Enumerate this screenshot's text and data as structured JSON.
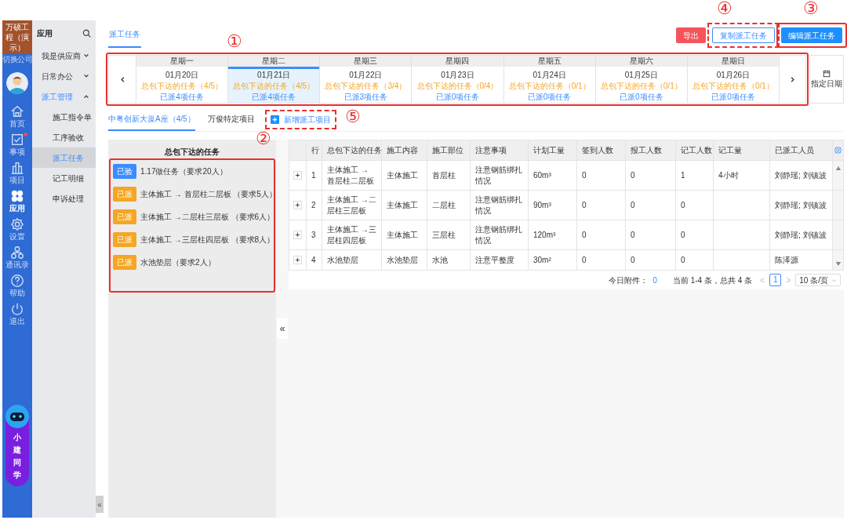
{
  "rail": {
    "brand": "万硕工程（演示）",
    "switch_label": "切换公司",
    "items": [
      {
        "label": "首页",
        "selected": false,
        "badge": false
      },
      {
        "label": "事项",
        "selected": false,
        "badge": true
      },
      {
        "label": "项目",
        "selected": false,
        "badge": false
      },
      {
        "label": "应用",
        "selected": true,
        "badge": false
      },
      {
        "label": "设置",
        "selected": false,
        "badge": false
      },
      {
        "label": "通讯录",
        "selected": false,
        "badge": false
      },
      {
        "label": "帮助",
        "selected": false,
        "badge": false
      },
      {
        "label": "退出",
        "selected": false,
        "badge": false
      }
    ],
    "assistant": "小建同学"
  },
  "sidebar": {
    "title": "应用",
    "items": [
      {
        "label": "我是供应商",
        "expanded": false
      },
      {
        "label": "日常办公",
        "expanded": false
      },
      {
        "label": "派工管理",
        "expanded": true,
        "children": [
          {
            "label": "施工指令单",
            "selected": false
          },
          {
            "label": "工序验收",
            "selected": false
          },
          {
            "label": "派工任务",
            "selected": true
          },
          {
            "label": "记工明细",
            "selected": false
          },
          {
            "label": "申诉处理",
            "selected": false
          }
        ]
      }
    ]
  },
  "page_tabs": [
    {
      "label": "派工任务",
      "selected": true
    }
  ],
  "actions": [
    {
      "label": "导出",
      "kind": "danger"
    },
    {
      "label": "复制派工任务",
      "kind": "outline"
    },
    {
      "label": "编辑派工任务",
      "kind": "primary"
    }
  ],
  "week": {
    "days": [
      {
        "weekday": "星期一",
        "date": "01月20日",
        "issued": "总包下达的任务（4/5）",
        "dispatched": "已派4项任务",
        "selected": false
      },
      {
        "weekday": "星期二",
        "date": "01月21日",
        "issued": "总包下达的任务（4/5）",
        "dispatched": "已派4项任务",
        "selected": true
      },
      {
        "weekday": "星期三",
        "date": "01月22日",
        "issued": "总包下达的任务（3/4）",
        "dispatched": "已派3项任务",
        "selected": false
      },
      {
        "weekday": "星期四",
        "date": "01月23日",
        "issued": "总包下达的任务（0/4）",
        "dispatched": "已派0项任务",
        "selected": false
      },
      {
        "weekday": "星期五",
        "date": "01月24日",
        "issued": "总包下达的任务（0/1）",
        "dispatched": "已派0项任务",
        "selected": false
      },
      {
        "weekday": "星期六",
        "date": "01月25日",
        "issued": "总包下达的任务（0/1）",
        "dispatched": "已派0项任务",
        "selected": false
      },
      {
        "weekday": "星期日",
        "date": "01月26日",
        "issued": "总包下达的任务（0/1）",
        "dispatched": "已派0项任务",
        "selected": false
      }
    ],
    "pick_date": "指定日期"
  },
  "project_tabs": [
    {
      "label": "中粤创新大厦A座（4/5）",
      "selected": true
    },
    {
      "label": "万俊特定项目",
      "selected": false
    }
  ],
  "add_project": "新增派工项目",
  "task_panel": {
    "title": "总包下达的任务",
    "items": [
      {
        "tag": "已验",
        "kind": "verified",
        "text": "1.17做任务（要求20人）"
      },
      {
        "tag": "已派",
        "kind": "dispatched",
        "text": "主体施工 → 首层柱二层板 （要求5人）"
      },
      {
        "tag": "已派",
        "kind": "dispatched",
        "text": "主体施工 →二层柱三层板 （要求6人）"
      },
      {
        "tag": "已派",
        "kind": "dispatched",
        "text": "主体施工 →三层柱四层板 （要求8人）"
      },
      {
        "tag": "已派",
        "kind": "dispatched",
        "text": "水池垫层（要求2人）"
      }
    ]
  },
  "table": {
    "columns": [
      "行",
      "总包下达的任务",
      "施工内容",
      "施工部位",
      "注意事项",
      "计划工量",
      "签到人数",
      "报工人数",
      "记工人数",
      "记工量",
      "已派工人员"
    ],
    "rows": [
      {
        "expand": "+",
        "cells": [
          "1",
          "主体施工 → 首层柱二层板",
          "主体施工",
          "首层柱",
          "注意钢筋绑扎情况",
          "60m³",
          "0",
          "0",
          "1",
          "4小时",
          "刘静瑶; 刘镇波"
        ]
      },
      {
        "expand": "+",
        "cells": [
          "2",
          "主体施工 →二层柱三层板",
          "主体施工",
          "二层柱",
          "注意钢筋绑扎情况",
          "90m³",
          "0",
          "0",
          "0",
          "",
          "刘静瑶; 刘镇波"
        ]
      },
      {
        "expand": "+",
        "cells": [
          "3",
          "主体施工 →三层柱四层板",
          "主体施工",
          "三层柱",
          "注意钢筋绑扎情况",
          "120m³",
          "0",
          "0",
          "0",
          "",
          "刘静瑶; 刘镇波"
        ]
      },
      {
        "expand": "+",
        "cells": [
          "4",
          "水池垫层",
          "水池垫层",
          "水池",
          "注意平整度",
          "30m²",
          "0",
          "0",
          "0",
          "",
          "陈泽源"
        ]
      }
    ]
  },
  "footer": {
    "attachments_label": "今日附件：",
    "attachments_count": "0",
    "summary": "当前 1-4 条，总共 4 条",
    "prev": "<",
    "page": "1",
    "next": ">",
    "page_size": "10 条/页"
  },
  "collapse": [
    "«",
    "«"
  ],
  "annotations": [
    {
      "label": "①"
    },
    {
      "label": "②"
    },
    {
      "label": "③"
    },
    {
      "label": "④"
    },
    {
      "label": "⑤"
    }
  ]
}
